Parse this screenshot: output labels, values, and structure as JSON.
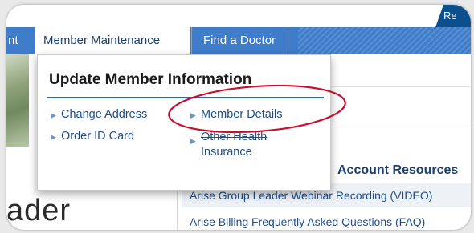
{
  "colors": {
    "nav_bg": "#3f7cc9",
    "active_tab_text": "#1b3f6e",
    "link": "#1e4d8c",
    "divider": "#2f67ad",
    "annotation": "#c8102e",
    "top_tab": "#0d4f8c"
  },
  "header": {
    "top_tab_label": "Re"
  },
  "nav": {
    "left_partial": "nt",
    "member_maintenance": "Member Maintenance",
    "find_doctor": "Find a Doctor"
  },
  "dropdown": {
    "title": "Update Member Information",
    "links": {
      "change_address": "Change Address",
      "order_id_card": "Order ID Card",
      "member_details": "Member Details",
      "other_health_line1": "Other Health",
      "other_health_line2": "Insurance"
    },
    "arrow_icon": "double-arrow-right-icon"
  },
  "page": {
    "left_headline": "ader",
    "resources_heading": "Account Resources",
    "resources": [
      "Arise Group Leader Webinar Recording (VIDEO)",
      "Arise Billing Frequently Asked Questions (FAQ)"
    ]
  }
}
